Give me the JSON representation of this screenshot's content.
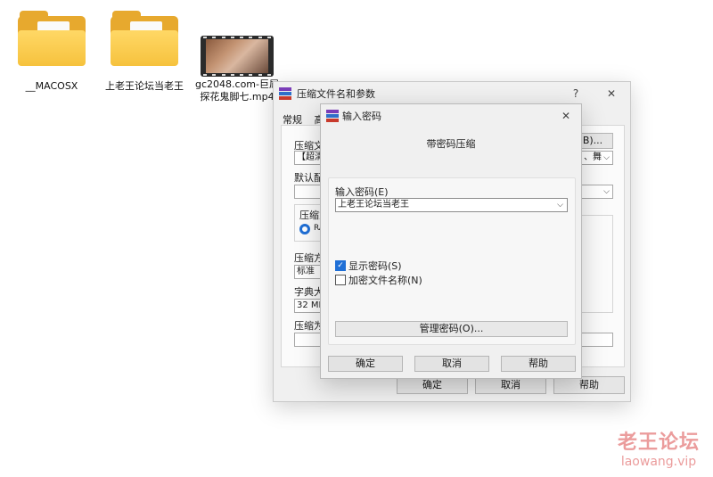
{
  "desktop": {
    "icons": [
      {
        "label": "__MACOSX",
        "type": "folder"
      },
      {
        "label": "上老王论坛当老王",
        "type": "folder"
      },
      {
        "label": "gc2048.com-巨屌探花鬼脚七.mp4",
        "type": "video"
      }
    ]
  },
  "outer_dialog": {
    "title": "压缩文件名和参数",
    "help_glyph": "?",
    "close_glyph": "✕",
    "tabs": [
      "常规",
      "高"
    ],
    "labels": {
      "archive_name": "压缩文",
      "default_profile": "默认配",
      "format": "压缩方",
      "format_radio": "RA",
      "method": "压缩方",
      "method_value": "标准",
      "dict": "字典大",
      "dict_value": "32 MB",
      "split": "压缩为"
    },
    "archive_value": "【超清",
    "browse_btn": "B)...",
    "profile_combo_tail": "、舞",
    "buttons": {
      "ok": "确定",
      "cancel": "取消",
      "help": "帮助"
    }
  },
  "password_dialog": {
    "title": "输入密码",
    "close_glyph": "✕",
    "subtitle": "带密码压缩",
    "password_label": "输入密码(E)",
    "password_value": "上老王论坛当老王",
    "show_password": {
      "label": "显示密码(S)",
      "checked": true
    },
    "encrypt_names": {
      "label": "加密文件名称(N)",
      "checked": false
    },
    "manage_button": "管理密码(O)...",
    "buttons": {
      "ok": "确定",
      "cancel": "取消",
      "help": "帮助"
    }
  },
  "watermark": {
    "line1": "老王论坛",
    "line2": "laowang.vip"
  }
}
